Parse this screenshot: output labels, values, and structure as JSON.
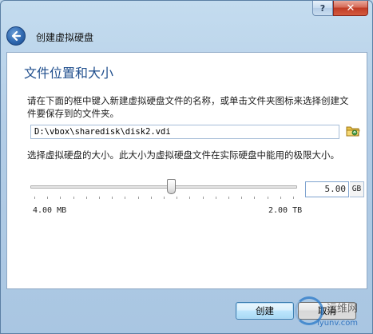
{
  "window": {
    "help_glyph": "?",
    "close_glyph": "✕"
  },
  "header": {
    "title": "创建虚拟硬盘"
  },
  "section": {
    "title": "文件位置和大小",
    "description": "请在下面的框中键入新建虚拟硬盘文件的名称，或单击文件夹图标来选择创建文件要保存到的文件夹。",
    "file_path": "D:\\vbox\\sharedisk\\disk2.vdi",
    "size_label": "选择虚拟硬盘的大小。此大小为虚拟硬盘文件在实际硬盘中能用的极限大小。",
    "size_value": "5.00",
    "size_unit": "GB",
    "range_min": "4.00 MB",
    "range_max": "2.00 TB",
    "slider_fraction": 0.53
  },
  "buttons": {
    "create": "创建",
    "cancel": "取消"
  },
  "watermark": {
    "text1": "运维网",
    "text2": "iyunv.com"
  },
  "colors": {
    "accent": "#1f4e8d",
    "close": "#c03b25"
  },
  "icons": {
    "back": "back-arrow-icon",
    "folder": "folder-icon"
  }
}
